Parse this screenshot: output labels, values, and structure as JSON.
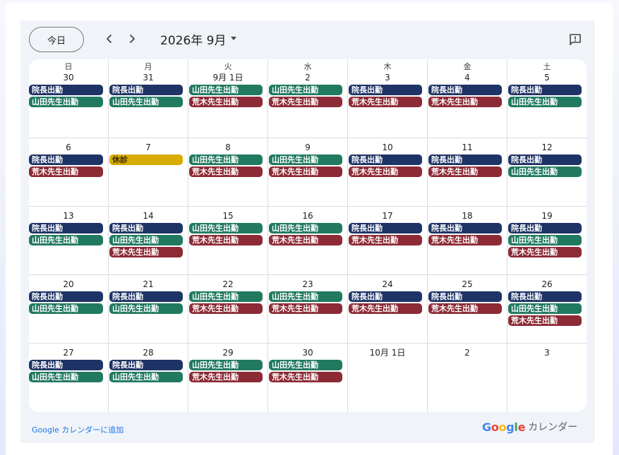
{
  "toolbar": {
    "today_label": "今日",
    "month_label": "2026年 9月"
  },
  "colors": {
    "director": "#1e3466",
    "yamada": "#217a60",
    "araki": "#8c2a35",
    "closed": "#d9ac00",
    "closed_text": "#3b2f00",
    "link": "#1a73e8"
  },
  "weekdays": [
    "日",
    "月",
    "火",
    "水",
    "木",
    "金",
    "土"
  ],
  "weeks": [
    {
      "days": [
        {
          "label": "30",
          "events": [
            {
              "title": "院長出勤",
              "kind": "director"
            },
            {
              "title": "山田先生出勤",
              "kind": "yamada"
            }
          ]
        },
        {
          "label": "31",
          "events": [
            {
              "title": "院長出勤",
              "kind": "director"
            },
            {
              "title": "山田先生出勤",
              "kind": "yamada"
            }
          ]
        },
        {
          "label": "9月 1日",
          "events": [
            {
              "title": "山田先生出勤",
              "kind": "yamada"
            },
            {
              "title": "荒木先生出勤",
              "kind": "araki"
            }
          ]
        },
        {
          "label": "2",
          "events": [
            {
              "title": "山田先生出勤",
              "kind": "yamada"
            },
            {
              "title": "荒木先生出勤",
              "kind": "araki"
            }
          ]
        },
        {
          "label": "3",
          "events": [
            {
              "title": "院長出勤",
              "kind": "director"
            },
            {
              "title": "荒木先生出勤",
              "kind": "araki"
            }
          ]
        },
        {
          "label": "4",
          "events": [
            {
              "title": "院長出勤",
              "kind": "director"
            },
            {
              "title": "荒木先生出勤",
              "kind": "araki"
            }
          ]
        },
        {
          "label": "5",
          "events": [
            {
              "title": "院長出勤",
              "kind": "director"
            },
            {
              "title": "山田先生出勤",
              "kind": "yamada"
            }
          ]
        }
      ]
    },
    {
      "days": [
        {
          "label": "6",
          "events": [
            {
              "title": "院長出勤",
              "kind": "director"
            },
            {
              "title": "荒木先生出勤",
              "kind": "araki"
            }
          ]
        },
        {
          "label": "7",
          "events": [
            {
              "title": "休診",
              "kind": "closed"
            }
          ]
        },
        {
          "label": "8",
          "events": [
            {
              "title": "山田先生出勤",
              "kind": "yamada"
            },
            {
              "title": "荒木先生出勤",
              "kind": "araki"
            }
          ]
        },
        {
          "label": "9",
          "events": [
            {
              "title": "山田先生出勤",
              "kind": "yamada"
            },
            {
              "title": "荒木先生出勤",
              "kind": "araki"
            }
          ]
        },
        {
          "label": "10",
          "events": [
            {
              "title": "院長出勤",
              "kind": "director"
            },
            {
              "title": "荒木先生出勤",
              "kind": "araki"
            }
          ]
        },
        {
          "label": "11",
          "events": [
            {
              "title": "院長出勤",
              "kind": "director"
            },
            {
              "title": "荒木先生出勤",
              "kind": "araki"
            }
          ]
        },
        {
          "label": "12",
          "events": [
            {
              "title": "院長出勤",
              "kind": "director"
            },
            {
              "title": "山田先生出勤",
              "kind": "yamada"
            }
          ]
        }
      ]
    },
    {
      "days": [
        {
          "label": "13",
          "events": [
            {
              "title": "院長出勤",
              "kind": "director"
            },
            {
              "title": "山田先生出勤",
              "kind": "yamada"
            }
          ]
        },
        {
          "label": "14",
          "events": [
            {
              "title": "院長出勤",
              "kind": "director"
            },
            {
              "title": "山田先生出勤",
              "kind": "yamada"
            },
            {
              "title": "荒木先生出勤",
              "kind": "araki"
            }
          ]
        },
        {
          "label": "15",
          "events": [
            {
              "title": "山田先生出勤",
              "kind": "yamada"
            },
            {
              "title": "荒木先生出勤",
              "kind": "araki"
            }
          ]
        },
        {
          "label": "16",
          "events": [
            {
              "title": "山田先生出勤",
              "kind": "yamada"
            },
            {
              "title": "荒木先生出勤",
              "kind": "araki"
            }
          ]
        },
        {
          "label": "17",
          "events": [
            {
              "title": "院長出勤",
              "kind": "director"
            },
            {
              "title": "荒木先生出勤",
              "kind": "araki"
            }
          ]
        },
        {
          "label": "18",
          "events": [
            {
              "title": "院長出勤",
              "kind": "director"
            },
            {
              "title": "荒木先生出勤",
              "kind": "araki"
            }
          ]
        },
        {
          "label": "19",
          "events": [
            {
              "title": "院長出勤",
              "kind": "director"
            },
            {
              "title": "山田先生出勤",
              "kind": "yamada"
            },
            {
              "title": "荒木先生出勤",
              "kind": "araki"
            }
          ]
        }
      ]
    },
    {
      "days": [
        {
          "label": "20",
          "events": [
            {
              "title": "院長出勤",
              "kind": "director"
            },
            {
              "title": "山田先生出勤",
              "kind": "yamada"
            }
          ]
        },
        {
          "label": "21",
          "events": [
            {
              "title": "院長出勤",
              "kind": "director"
            },
            {
              "title": "山田先生出勤",
              "kind": "yamada"
            }
          ]
        },
        {
          "label": "22",
          "events": [
            {
              "title": "山田先生出勤",
              "kind": "yamada"
            },
            {
              "title": "荒木先生出勤",
              "kind": "araki"
            }
          ]
        },
        {
          "label": "23",
          "events": [
            {
              "title": "山田先生出勤",
              "kind": "yamada"
            },
            {
              "title": "荒木先生出勤",
              "kind": "araki"
            }
          ]
        },
        {
          "label": "24",
          "events": [
            {
              "title": "院長出勤",
              "kind": "director"
            },
            {
              "title": "荒木先生出勤",
              "kind": "araki"
            }
          ]
        },
        {
          "label": "25",
          "events": [
            {
              "title": "院長出勤",
              "kind": "director"
            },
            {
              "title": "荒木先生出勤",
              "kind": "araki"
            }
          ]
        },
        {
          "label": "26",
          "events": [
            {
              "title": "院長出勤",
              "kind": "director"
            },
            {
              "title": "山田先生出勤",
              "kind": "yamada"
            },
            {
              "title": "荒木先生出勤",
              "kind": "araki"
            }
          ]
        }
      ]
    },
    {
      "days": [
        {
          "label": "27",
          "events": [
            {
              "title": "院長出勤",
              "kind": "director"
            },
            {
              "title": "山田先生出勤",
              "kind": "yamada"
            }
          ]
        },
        {
          "label": "28",
          "events": [
            {
              "title": "院長出勤",
              "kind": "director"
            },
            {
              "title": "山田先生出勤",
              "kind": "yamada"
            }
          ]
        },
        {
          "label": "29",
          "events": [
            {
              "title": "山田先生出勤",
              "kind": "yamada"
            },
            {
              "title": "荒木先生出勤",
              "kind": "araki"
            }
          ]
        },
        {
          "label": "30",
          "events": [
            {
              "title": "山田先生出勤",
              "kind": "yamada"
            },
            {
              "title": "荒木先生出勤",
              "kind": "araki"
            }
          ]
        },
        {
          "label": "10月 1日",
          "events": []
        },
        {
          "label": "2",
          "events": []
        },
        {
          "label": "3",
          "events": []
        }
      ]
    }
  ],
  "footer": {
    "add_link": "Google カレンダーに追加",
    "brand_logo": "Google",
    "brand_text": "カレンダー"
  },
  "icons": {
    "prev": "chevron-left-icon",
    "next": "chevron-right-icon",
    "dropdown": "caret-down-icon",
    "feedback": "feedback-icon"
  }
}
